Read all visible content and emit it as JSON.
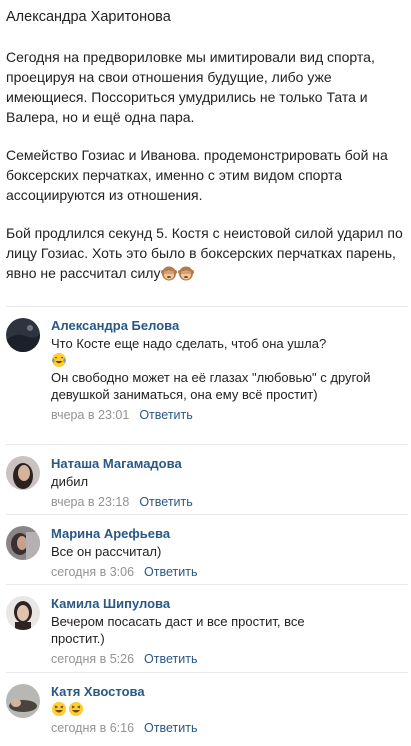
{
  "post": {
    "author": "Александра Харитонова",
    "paragraphs": [
      "Сегодня на предвориловке мы имитировали вид спорта, проецируя на свои отношения будущие, либо уже имеющиеся. Поссориться умудрились не только Тата и Валера, но и ещё одна пара.",
      "Семейство Гозиас и Иванова. продемонстрировать бой на боксерских перчатках, именно с этим видом спорта ассоциируются из отношения.",
      "Бой продлился секунд 5. Костя с неистовой силой ударил по лицу Гозиас. Хоть это было в боксерских перчатках парень, явно не рассчитал силу"
    ],
    "end_emoji": [
      "see-no-evil-monkey-icon",
      "see-no-evil-monkey-icon"
    ]
  },
  "comments": [
    {
      "author": "Александра Белова",
      "text_1": "Что Косте еще надо сделать, чтоб она ушла?",
      "emoji": "tears-of-joy-icon",
      "text_2": "Он свободно может на её глазах \"любовью\" с другой девушкой заниматься, она ему всё простит)",
      "date": "вчера в 23:01",
      "reply": "Ответить"
    },
    {
      "author": "Наташа Магамадова",
      "text_1": "дибил",
      "date": "вчера в 23:18",
      "reply": "Ответить"
    },
    {
      "author": "Марина Арефьева",
      "text_1": "Все он рассчитал)",
      "date": "сегодня в 3:06",
      "reply": "Ответить"
    },
    {
      "author": "Камила Шипулова",
      "text_1": "Вечером посасать даст и все простит, все простит.)",
      "date": "сегодня в 5:26",
      "reply": "Ответить"
    },
    {
      "author": "Катя Хвостова",
      "emoji": [
        "laughing-face-icon",
        "laughing-face-icon"
      ],
      "date": "сегодня в 6:16",
      "reply": "Ответить"
    }
  ],
  "colors": {
    "link": "#2a5885",
    "meta": "#939393",
    "divider": "#e7e8ec"
  }
}
